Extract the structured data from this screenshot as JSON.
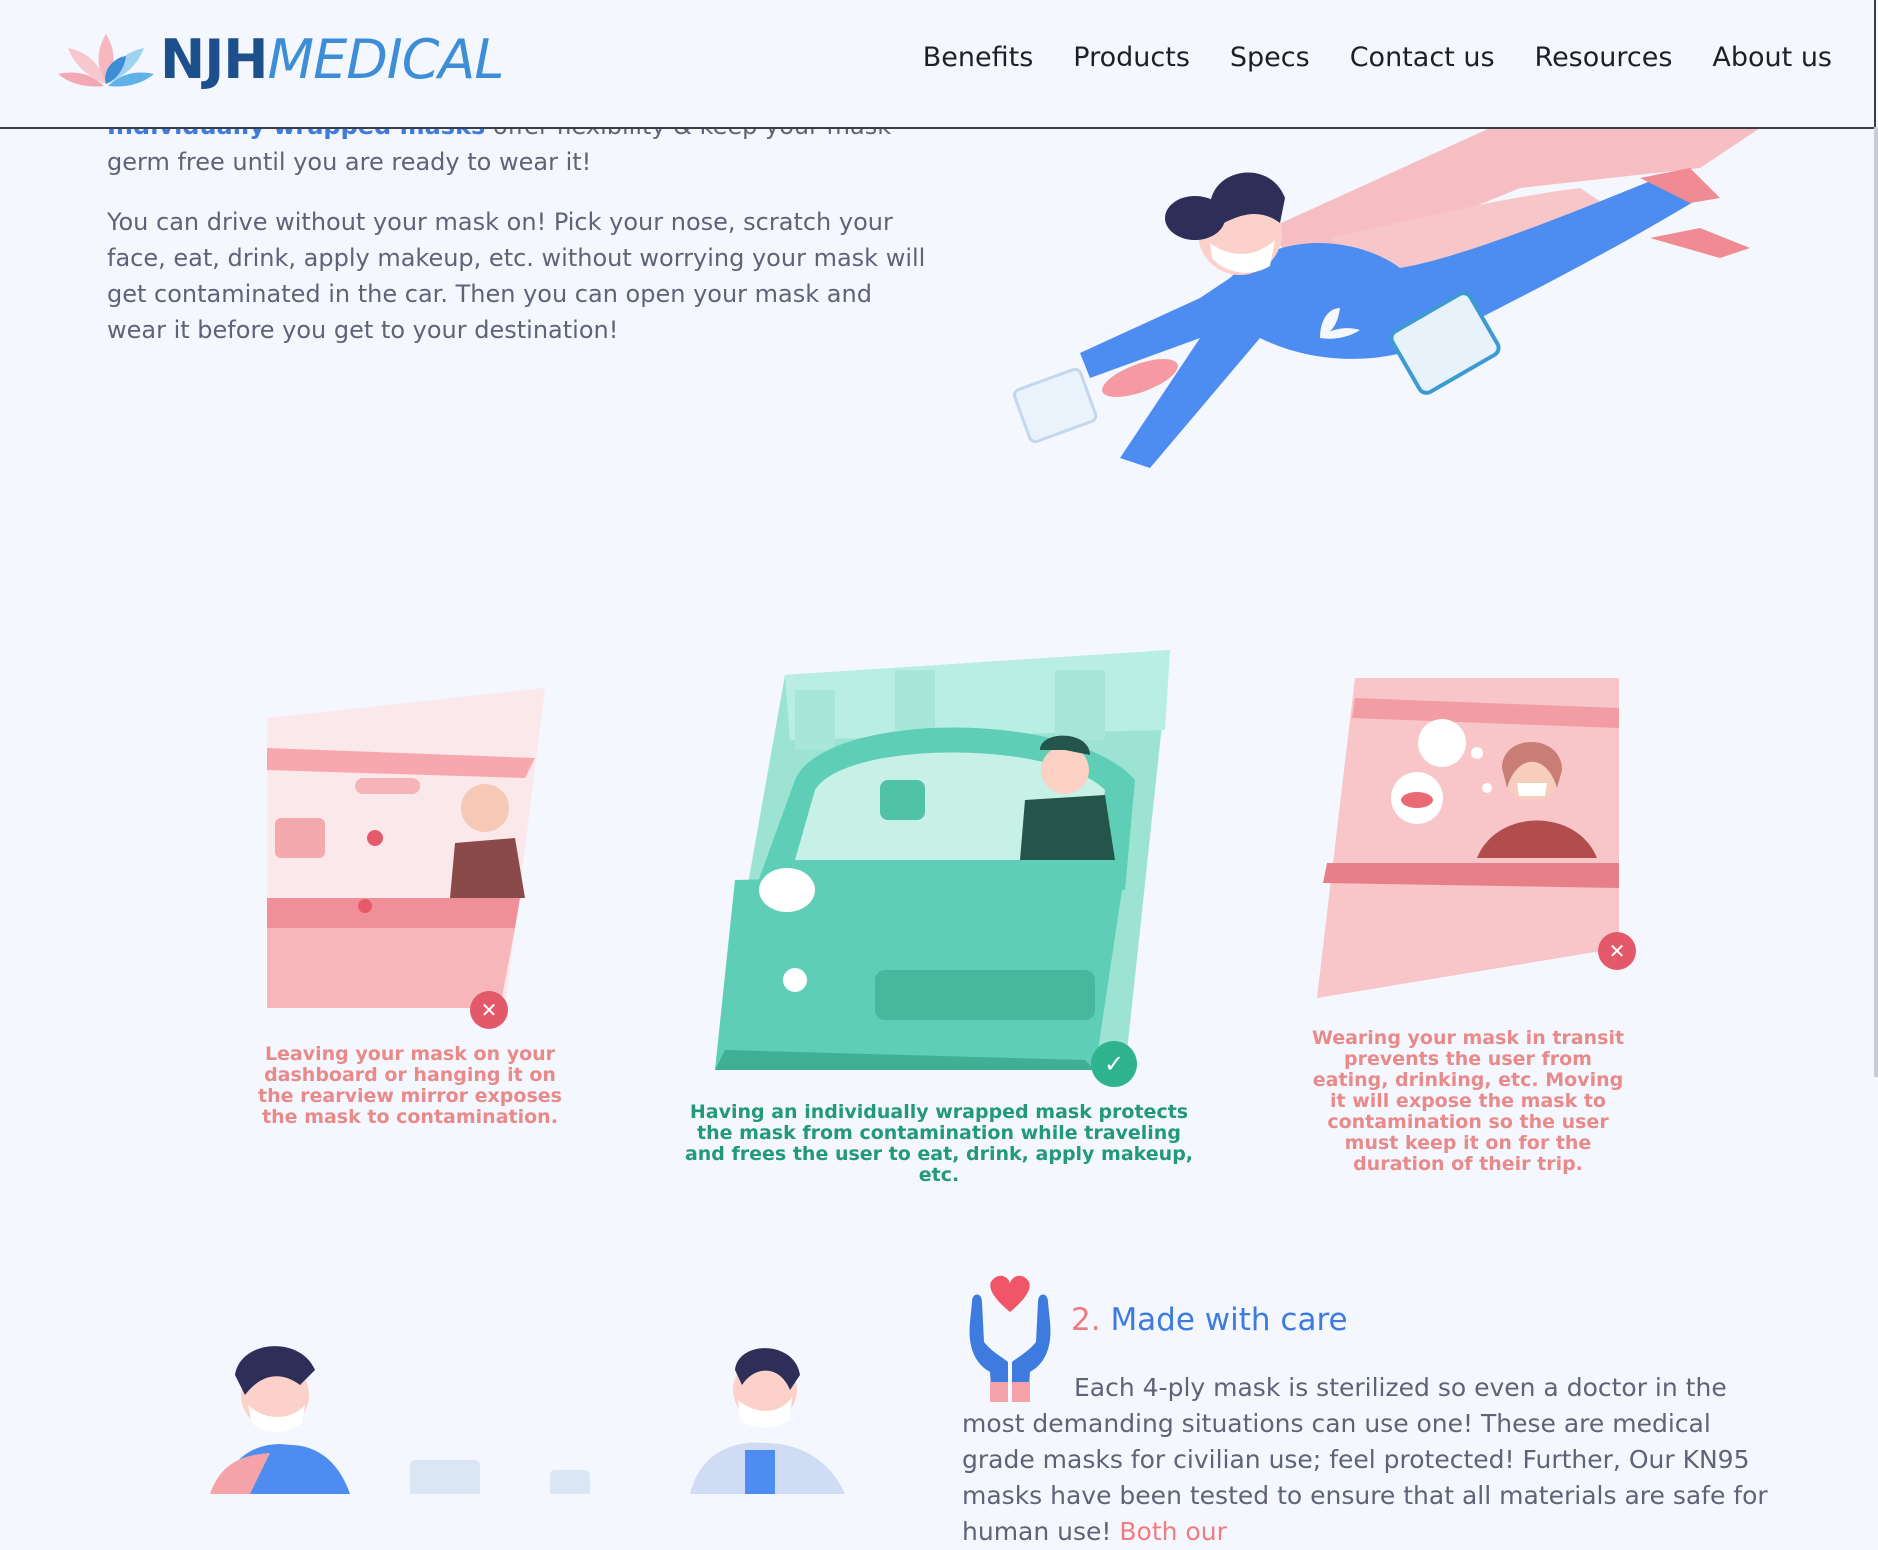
{
  "brand": {
    "logo_part1": "NJH",
    "logo_part2": "MEDICAL"
  },
  "nav": [
    "Benefits",
    "Products",
    "Specs",
    "Contact us",
    "Resources",
    "About us"
  ],
  "intro": {
    "highlight": "Individually wrapped masks",
    "para1_rest": " offer flexibility & keep your mask germ free until you are ready to wear it!",
    "para2": "You can drive without your mask on! Pick your nose, scratch your face, eat, drink, apply makeup, etc. without worrying your mask will get contaminated in the car. Then you can open your mask and wear it before you get to your destination!"
  },
  "scenarios": [
    {
      "caption": "Leaving your mask on your dashboard or hanging it on the rearview mirror exposes the mask to contamination.",
      "status": "bad"
    },
    {
      "caption": "Having an individually wrapped mask protects the mask from contamination while traveling and frees the user to eat, drink, apply makeup, etc.",
      "status": "good"
    },
    {
      "caption": "Wearing your mask in transit prevents the user from eating, drinking, etc. Moving it will expose the mask to contamination so the user must keep it on for the duration of their trip.",
      "status": "bad"
    }
  ],
  "care": {
    "number": "2.",
    "title": "Made with care",
    "body": "Each 4-ply mask is sterilized so even a doctor in the most demanding situations can use one! These are medical grade masks for civilian use; feel protected! Further, Our KN95 masks have been tested to ensure that all materials are safe for human use!",
    "link_text": "Both our"
  },
  "icons": {
    "bad_badge": "close-icon",
    "good_badge": "check-icon",
    "care_icon": "hands-heart-icon",
    "logo_icon": "lotus-icon"
  },
  "colors": {
    "accent_blue": "#3d7cde",
    "logo_navy": "#1d4f8c",
    "warning_red": "#e4596a",
    "success_green": "#2fb38e",
    "pink": "#f07c82"
  }
}
